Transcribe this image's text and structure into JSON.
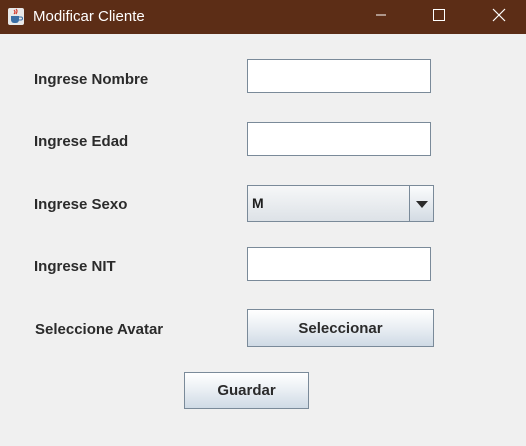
{
  "window": {
    "title": "Modificar Cliente",
    "titlebar_color": "#5c2d16",
    "icon": "java-cup-icon",
    "controls": [
      "minimize-icon",
      "maximize-icon",
      "close-icon"
    ]
  },
  "form": {
    "nombre_label": "Ingrese Nombre",
    "nombre_value": "",
    "edad_label": "Ingrese Edad",
    "edad_value": "",
    "sexo_label": "Ingrese Sexo",
    "sexo_selected": "M",
    "nit_label": "Ingrese NIT",
    "nit_value": "",
    "avatar_label": "Seleccione Avatar",
    "avatar_button": "Seleccionar",
    "save_button": "Guardar"
  }
}
